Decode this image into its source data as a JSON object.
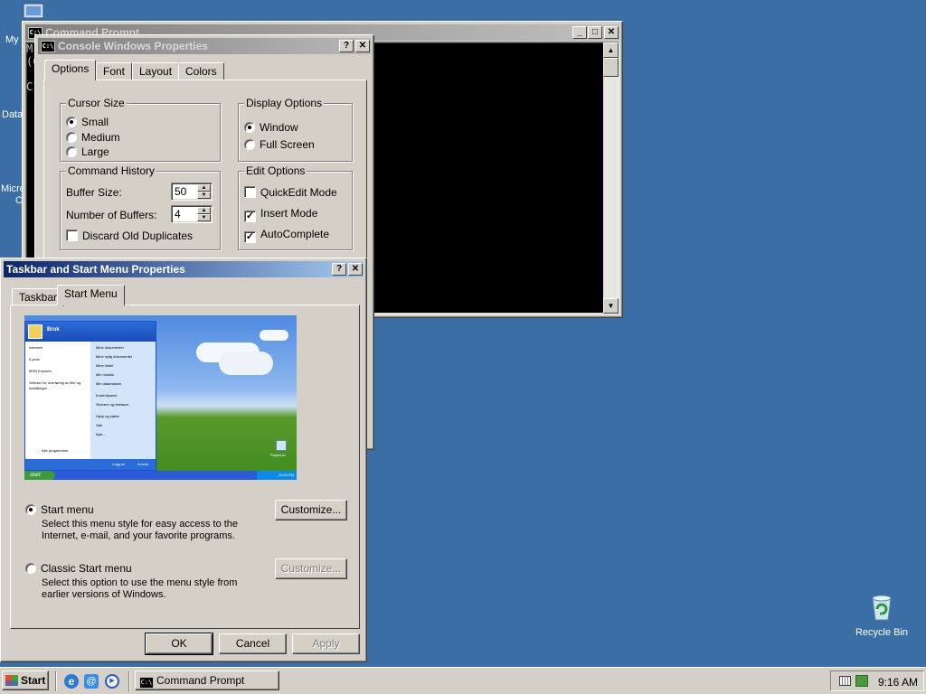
{
  "desktop": {
    "left_labels": [
      "My",
      "Data",
      "Micro",
      "C"
    ],
    "recycle_bin": "Recycle Bin"
  },
  "cmd_window": {
    "title": "Command Prompt",
    "left_text": [
      "M",
      "(C",
      "C"
    ]
  },
  "console_props": {
    "title": "Console Windows Properties",
    "tabs": [
      "Options",
      "Font",
      "Layout",
      "Colors"
    ],
    "cursor_size": {
      "label": "Cursor Size",
      "options": [
        "Small",
        "Medium",
        "Large"
      ],
      "selected": "Small"
    },
    "display_options": {
      "label": "Display Options",
      "options": [
        "Window",
        "Full Screen"
      ],
      "selected": "Window"
    },
    "command_history": {
      "label": "Command History",
      "buffer_size_label": "Buffer Size:",
      "buffer_size_value": "50",
      "num_buffers_label": "Number of Buffers:",
      "num_buffers_value": "4",
      "discard_label": "Discard Old Duplicates",
      "discard_checked": false
    },
    "edit_options": {
      "label": "Edit Options",
      "quickedit_label": "QuickEdit Mode",
      "quickedit_checked": false,
      "insert_label": "Insert Mode",
      "insert_checked": true,
      "autocomplete_label": "AutoComplete",
      "autocomplete_checked": true
    }
  },
  "taskbar_props": {
    "title": "Taskbar and Start Menu Properties",
    "tabs": [
      "Taskbar",
      "Start Menu"
    ],
    "preview": {
      "user": "Bruk",
      "left_items": [
        "Internett",
        "E-post",
        "MSN Explorer",
        "Veiviser for overføring av filer og innstillinger"
      ],
      "right_items": [
        "Mine dokumenter",
        "Mine nylig dokumenter",
        "Mine bilder",
        "Min musikk",
        "Min datamaskin",
        "Kontrollpanel",
        "Skrivere og telefaxer",
        "Hjelp og støtte",
        "Søk",
        "Kjør..."
      ],
      "all_programs": "Alle programmer",
      "logoff": "Logg av",
      "shutdown": "Avslutt",
      "start": "start",
      "recycle": "Papirkurv",
      "clock": "12:00 PM"
    },
    "start_menu": {
      "label": "Start menu",
      "desc": [
        "Select this menu style for easy access to the",
        "Internet, e-mail, and your favorite programs."
      ],
      "selected": true
    },
    "classic_menu": {
      "label": "Classic Start menu",
      "desc": [
        "Select this option to use the menu style from",
        "earlier versions of Windows."
      ],
      "selected": false
    },
    "customize_label": "Customize...",
    "ok_label": "OK",
    "cancel_label": "Cancel",
    "apply_label": "Apply"
  },
  "taskbar": {
    "start_label": "Start",
    "task_label": "Command Prompt",
    "clock": "9:16 AM"
  }
}
